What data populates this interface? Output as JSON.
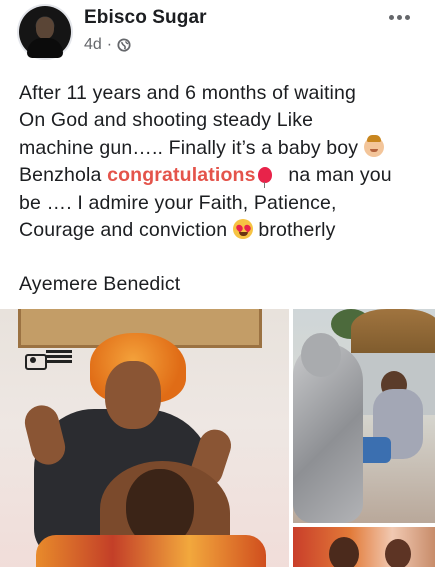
{
  "post": {
    "author": "Ebisco Sugar",
    "time": "4d",
    "separator": "·",
    "privacy_icon": "globe-icon",
    "more_icon": "more-options-icon",
    "lines": [
      "After 11 years and 6 months of waiting",
      "On God  and shooting steady Like",
      "machine gun…..   Finally it’s a baby boy",
      "Benzhola",
      "congratulations",
      "na man you",
      "be …. I admire your Faith, Patience,",
      "Courage and conviction",
      "brotherly",
      "Ayemere Benedict"
    ],
    "emojis": [
      "baby-emoji",
      "balloon-emoji",
      "heart-eyes-emoji"
    ]
  },
  "colors": {
    "text": "#1c1e21",
    "meta": "#65676b",
    "congratulations": "#e4544b"
  },
  "photos": [
    "main-photo",
    "side-photo-top",
    "side-photo-bottom"
  ]
}
